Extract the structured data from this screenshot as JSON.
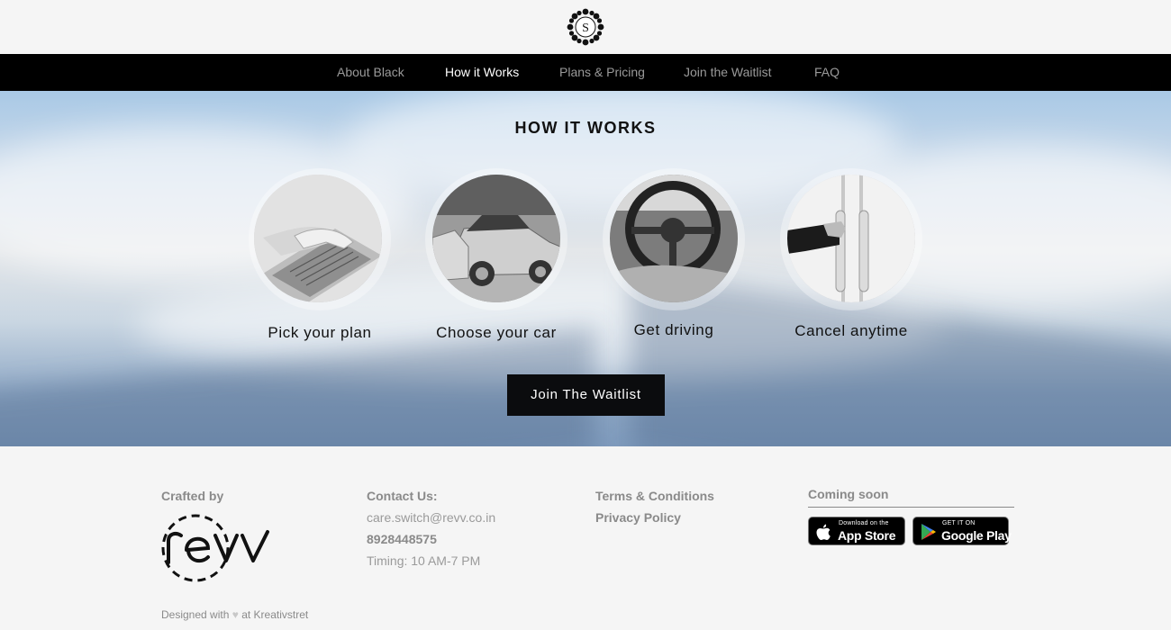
{
  "header": {
    "logo_letter": "S"
  },
  "nav": {
    "items": [
      {
        "label": "About Black",
        "active": false
      },
      {
        "label": "How it Works",
        "active": true
      },
      {
        "label": "Plans & Pricing",
        "active": false
      },
      {
        "label": "Join the Waitlist",
        "active": false
      },
      {
        "label": "FAQ",
        "active": false
      }
    ]
  },
  "hero": {
    "title": "HOW IT WORKS",
    "steps": [
      {
        "label": "Pick your plan",
        "icon": "laptop-typing-image"
      },
      {
        "label": "Choose your car",
        "icon": "parked-cars-image"
      },
      {
        "label": "Get driving",
        "icon": "steering-wheel-image"
      },
      {
        "label": "Cancel anytime",
        "icon": "door-handle-image"
      }
    ],
    "cta_label": "Join The Waitlist"
  },
  "footer": {
    "crafted_by": "Crafted by",
    "brand_logo": "revv",
    "contact": {
      "heading": "Contact Us:",
      "email": "care.switch@revv.co.in",
      "phone": "8928448575",
      "timing": "Timing: 10 AM-7 PM"
    },
    "links": {
      "terms": "Terms & Conditions",
      "privacy": "Privacy Policy"
    },
    "apps": {
      "heading": "Coming soon",
      "app_store_small": "Download on the",
      "app_store_big": "App Store",
      "google_play_small": "GET IT ON",
      "google_play_big": "Google Play"
    },
    "designed_prefix": "Designed with",
    "designed_heart": "♥",
    "designed_suffix": "at Kreativstret"
  },
  "colors": {
    "nav_bg": "#000000",
    "nav_active": "#ffffff",
    "nav_inactive": "#9a9a9a",
    "cta_bg": "#0b0c0e",
    "footer_text": "#8a8a8a"
  }
}
